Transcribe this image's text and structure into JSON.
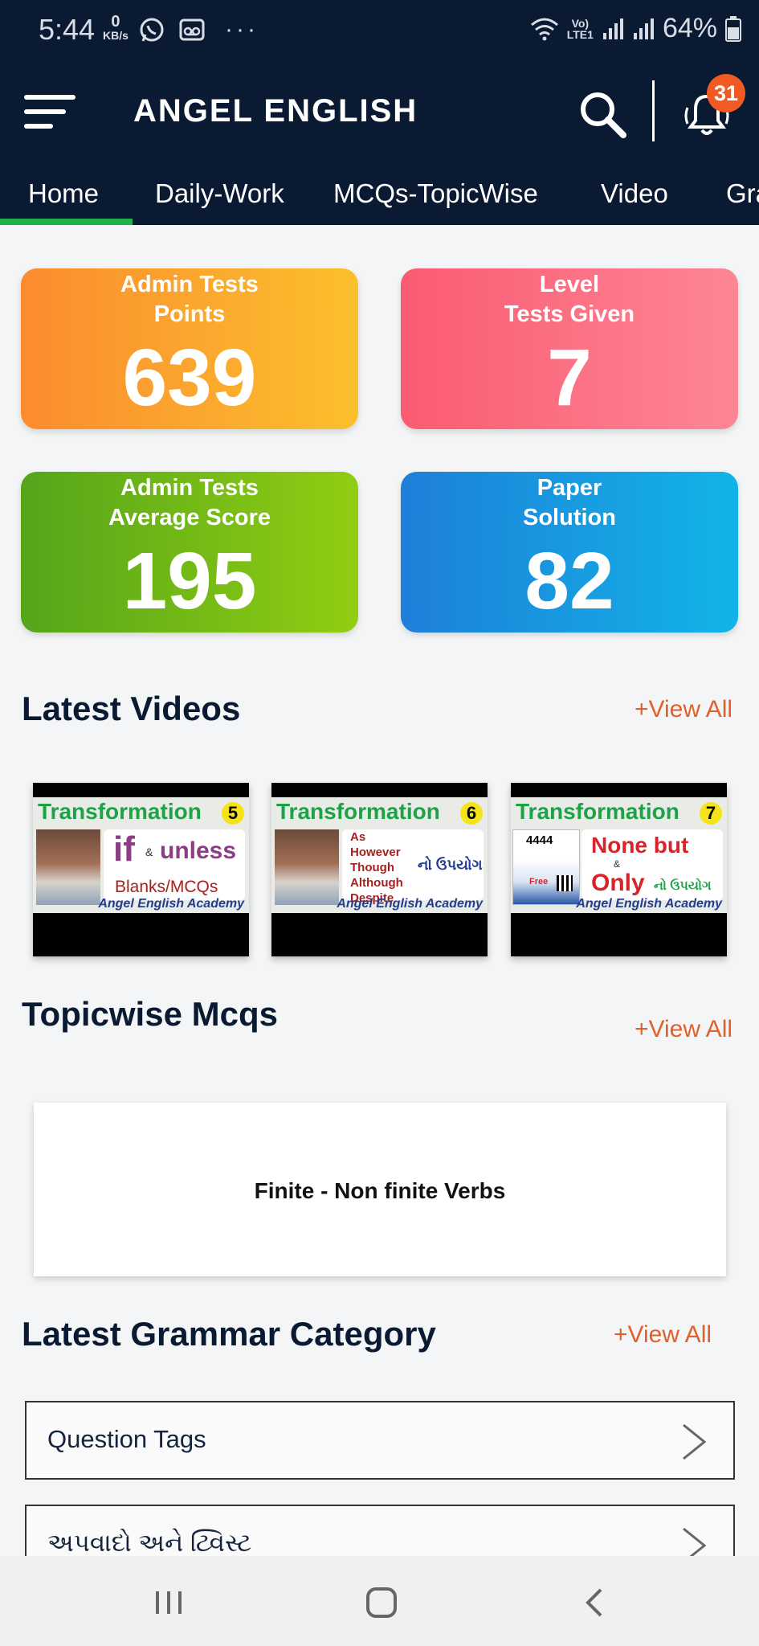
{
  "status_bar": {
    "time": "5:44",
    "kbs_value": "0",
    "kbs_unit": "KB/s",
    "more": "···",
    "network_label_top": "Vo)",
    "network_label_bottom": "LTE1",
    "battery": "64%"
  },
  "app_bar": {
    "title": "ANGEL ENGLISH",
    "notification_count": "31"
  },
  "tabs": [
    {
      "label": "Home",
      "active": true
    },
    {
      "label": "Daily-Work"
    },
    {
      "label": "MCQs-TopicWise"
    },
    {
      "label": "Video"
    },
    {
      "label": "Gra"
    }
  ],
  "stats": [
    {
      "line1": "Admin Tests",
      "line2": "Points",
      "value": "639",
      "color": "#fb8b2f"
    },
    {
      "line1": "Level",
      "line2": "Tests Given",
      "value": "7",
      "color": "#fb5b72"
    },
    {
      "line1": "Admin Tests",
      "line2": "Average Score",
      "value": "195",
      "color": "#55a51b"
    },
    {
      "line1": "Paper",
      "line2": "Solution",
      "value": "82",
      "color": "#1e7fd8"
    }
  ],
  "latest_videos": {
    "title": "Latest Videos",
    "view_all": "+View All",
    "items": [
      {
        "heading": "Transformation",
        "number": "5",
        "text_a": "if",
        "text_amp": "&",
        "text_b": "unless",
        "text_c": "Blanks/MCQs",
        "footer": "Angel English Academy"
      },
      {
        "heading": "Transformation",
        "number": "6",
        "lines": [
          "As",
          "However",
          "Though",
          "Although",
          "Despite"
        ],
        "gujarati": "નો ઉપયોગ",
        "footer": "Angel English Academy"
      },
      {
        "heading": "Transformation",
        "number": "7",
        "book_count": "4444",
        "book_free": "Free",
        "text_a": "None but",
        "text_amp": "&",
        "text_b": "Only",
        "gujarati": "નો ઉપયોગ",
        "footer": "Angel English Academy"
      }
    ]
  },
  "topicwise": {
    "title": "Topicwise Mcqs",
    "view_all": "+View All",
    "card": "Finite - Non finite Verbs"
  },
  "grammar": {
    "title": "Latest Grammar Category",
    "view_all": "+View All",
    "items": [
      "Question Tags",
      "અપવાદો અને ટ્વિસ્ટ"
    ]
  }
}
